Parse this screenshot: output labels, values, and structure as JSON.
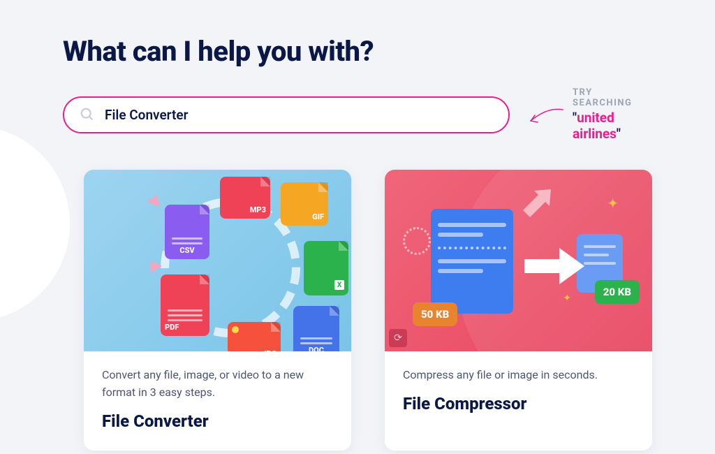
{
  "header": {
    "title": "What can I help you with?"
  },
  "search": {
    "value": "File Converter"
  },
  "hint": {
    "label": "TRY SEARCHING",
    "quote_open": "\"",
    "quote_close": "\"",
    "highlight": "united airlines"
  },
  "cards": [
    {
      "desc": "Convert any file, image, or video to a new format in 3 easy steps.",
      "title": "File Converter",
      "badges": {
        "csv": "CSV",
        "mp3": "MP3",
        "gif": "GIF",
        "pdf": "PDF",
        "jpg": "JPG",
        "doc": "DOC"
      }
    },
    {
      "desc": "Compress any file or image in seconds.",
      "title": "File Compressor",
      "sizes": {
        "large": "50 KB",
        "small": "20 KB"
      }
    }
  ]
}
